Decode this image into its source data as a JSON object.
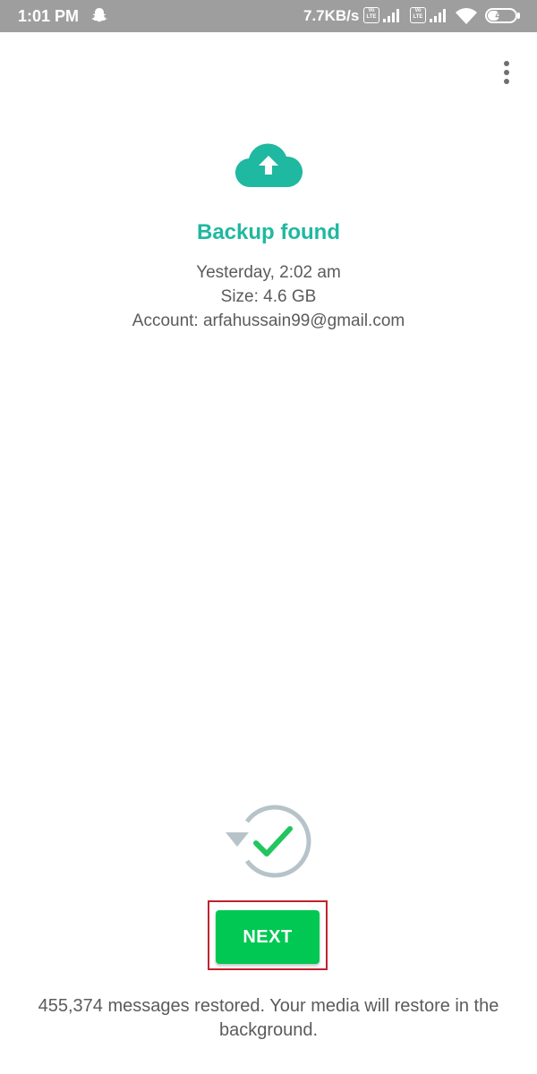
{
  "status_bar": {
    "time": "1:01 PM",
    "network_speed": "7.7KB/s",
    "volte_label": "Vo LTE",
    "battery_level": "44",
    "battery_percent": 44,
    "icons": [
      "snapchat-icon",
      "volte-icon",
      "signal-icon",
      "volte-icon",
      "signal-icon",
      "wifi-icon",
      "battery-icon"
    ]
  },
  "menu": {
    "icon": "more-vert-icon"
  },
  "backup": {
    "icon": "cloud-upload-icon",
    "title": "Backup found",
    "date": "Yesterday, 2:02 am",
    "size": "Size: 4.6 GB",
    "account": "Account: arfahussain99@gmail.com"
  },
  "restore": {
    "icon": "restore-complete-icon",
    "next_label": "NEXT",
    "message": "455,374 messages restored. Your media will restore in the background."
  },
  "colors": {
    "accent": "#1fb8a0",
    "button": "#00c853",
    "status_bar": "#9e9e9e",
    "highlight_outline": "#c0232e"
  }
}
